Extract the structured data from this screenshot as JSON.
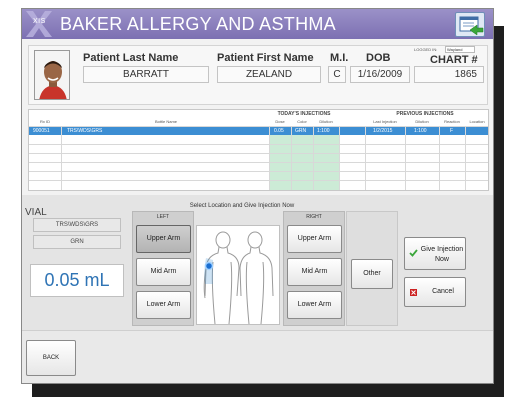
{
  "app": {
    "title": "BAKER ALLERGY AND ASTHMA",
    "logo_text": "XIS"
  },
  "patient": {
    "last_name_label": "Patient Last Name",
    "last_name": "BARRATT",
    "first_name_label": "Patient First Name",
    "first_name": "ZEALAND",
    "mi_label": "M.I.",
    "mi": "C",
    "dob_label": "DOB",
    "dob": "1/16/2009",
    "chart_label": "CHART #",
    "chart": "1865",
    "logged_in_label": "LOGGED IN:",
    "logged_in_user": "Wayland"
  },
  "grid": {
    "today_header": "TODAY'S INJECTIONS",
    "previous_header": "PREVIOUS INJECTIONS",
    "columns": [
      "Rx ID",
      "Bottle Name",
      "Dose",
      "Color",
      "Dilution",
      "Last Injection",
      "Dilution",
      "Reaction",
      "Location"
    ],
    "rows": [
      [
        "900051",
        "TRS\\WDS\\GRS",
        "0.05",
        "GRN",
        "1:100",
        "1/2/2015",
        "1:100",
        "F",
        ""
      ]
    ]
  },
  "vial": {
    "label": "VIAL",
    "bottle": "TRS\\WDS\\GRS",
    "color": "GRN",
    "dose": "0.05 mL"
  },
  "location": {
    "instruction": "Select Location and Give Injection Now",
    "left_label": "LEFT",
    "right_label": "RIGHT",
    "left_buttons": [
      "Upper Arm",
      "Mid Arm",
      "Lower Arm"
    ],
    "right_buttons": [
      "Upper Arm",
      "Mid Arm",
      "Lower Arm"
    ],
    "other_button": "Other",
    "selected": "left-upper-arm"
  },
  "actions": {
    "give_injection": "Give Injection Now",
    "cancel": "Cancel",
    "back": "BACK"
  },
  "colors": {
    "title_bar": "#8378b9",
    "selected_row": "#3c8ed3",
    "today_columns": "#ccebd6",
    "dose_text": "#2f74b5",
    "check": "#3aa63a",
    "cancel_x": "#cc2222"
  },
  "icons": {
    "exit": "exit-screen-icon",
    "check": "checkmark-icon",
    "cancel": "cancel-x-icon",
    "injection_marker": "injection-site-dot"
  }
}
